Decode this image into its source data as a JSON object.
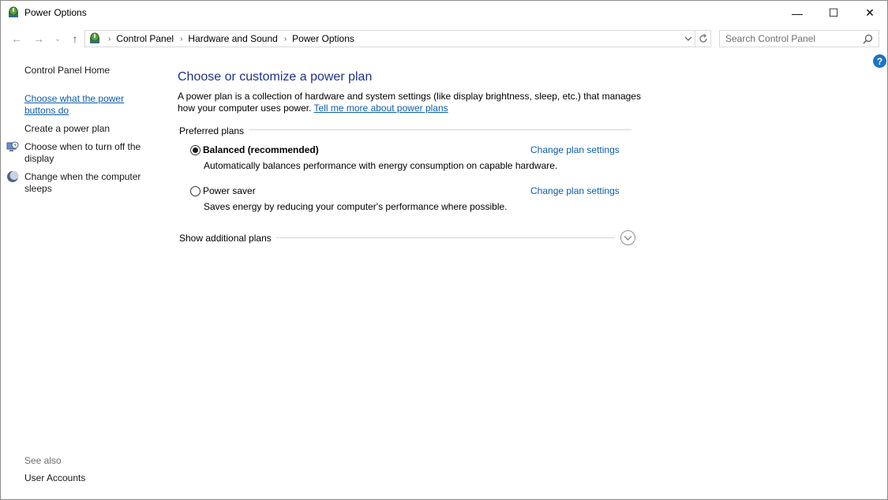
{
  "window": {
    "title": "Power Options",
    "controls": {
      "minimize": "—",
      "maximize": "☐",
      "close": "✕"
    }
  },
  "nav": {
    "back": "←",
    "forward": "→",
    "recent": "⌄",
    "up": "↑",
    "breadcrumbs": [
      "Control Panel",
      "Hardware and Sound",
      "Power Options"
    ],
    "search": {
      "placeholder": "Search Control Panel",
      "value": ""
    }
  },
  "left_pane": {
    "home": "Control Panel Home",
    "links": [
      "Choose what the power buttons do",
      "Create a power plan",
      "Choose when to turn off the display",
      "Change when the computer sleeps"
    ],
    "see_also_label": "See also",
    "see_also": [
      "User Accounts"
    ]
  },
  "main": {
    "title": "Choose or customize a power plan",
    "description": "A power plan is a collection of hardware and system settings (like display brightness, sleep, etc.) that manages how your computer uses power.",
    "learn_more": "Tell me more about power plans",
    "preferred_label": "Preferred plans",
    "plans": [
      {
        "name": "Balanced (recommended)",
        "description": "Automatically balances performance with energy consumption on capable hardware.",
        "link": "Change plan settings",
        "selected": true
      },
      {
        "name": "Power saver",
        "description": "Saves energy by reducing your computer's performance where possible.",
        "link": "Change plan settings",
        "selected": false
      }
    ],
    "additional_label": "Show additional plans"
  },
  "colors": {
    "link": "#0b5cad",
    "title": "#1e3287",
    "help": "#1e73c8"
  },
  "icons": [
    "power-options-icon",
    "monitor-clock-icon",
    "moon-sleep-icon",
    "help-icon",
    "search-icon",
    "refresh-icon",
    "chevron-down-icon"
  ]
}
